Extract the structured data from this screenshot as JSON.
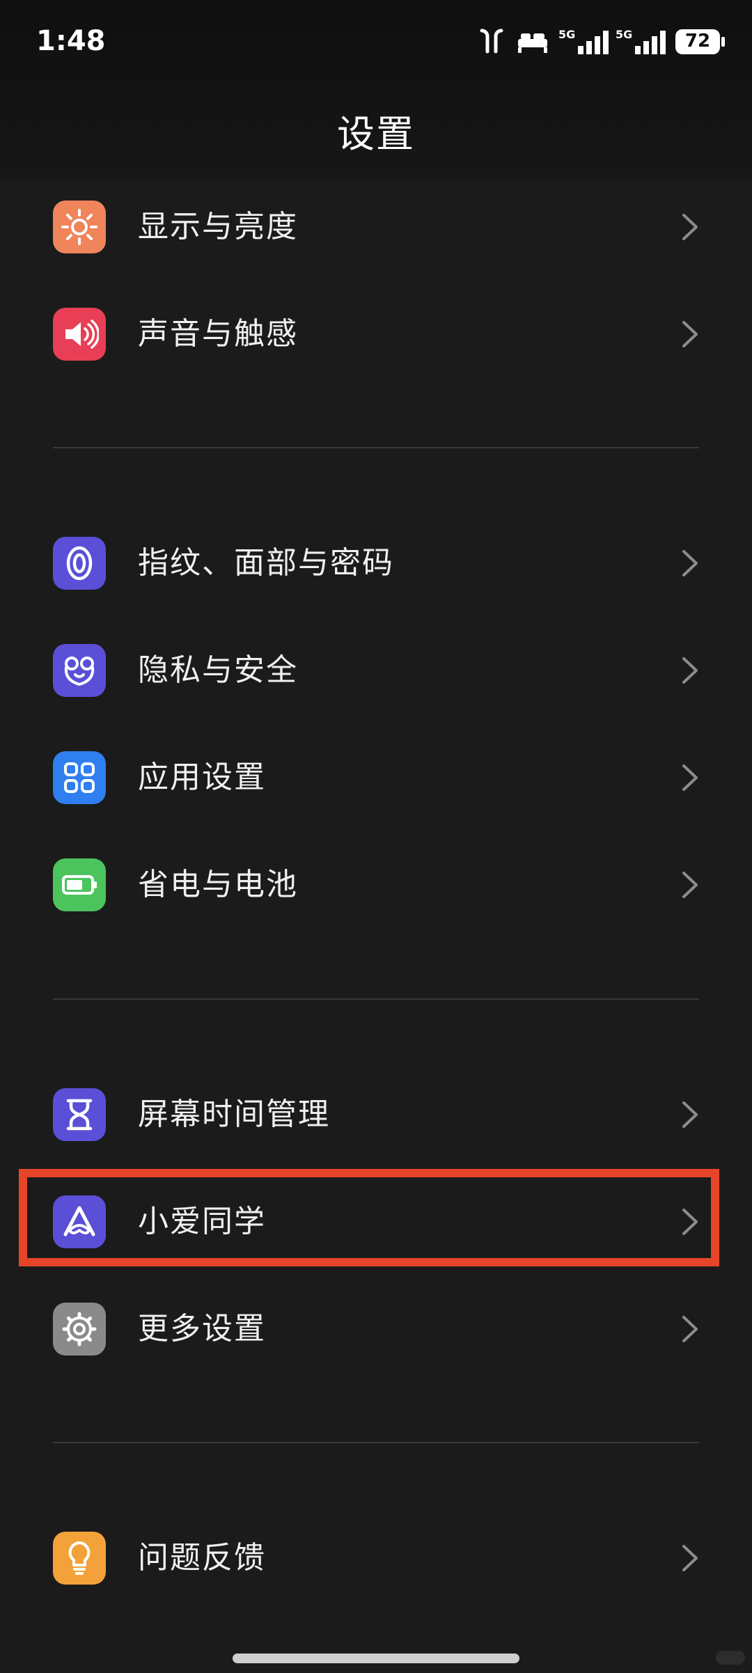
{
  "status_bar": {
    "time": "1:48",
    "battery": "72",
    "network1": "5G",
    "network2": "5G",
    "icons": [
      "earbuds-icon",
      "sleep-bed-icon",
      "signal-5g-icon",
      "signal-5g-icon",
      "battery-icon"
    ]
  },
  "header": {
    "title": "设置"
  },
  "groups": [
    {
      "items": [
        {
          "label": "显示与亮度",
          "icon": "sun-icon",
          "color": "#f0845a"
        },
        {
          "label": "声音与触感",
          "icon": "speaker-icon",
          "color": "#e83f56"
        }
      ]
    },
    {
      "items": [
        {
          "label": "指纹、面部与密码",
          "icon": "fingerprint-icon",
          "color": "#5a4fd6"
        },
        {
          "label": "隐私与安全",
          "icon": "privacy-icon",
          "color": "#5a4fd6"
        },
        {
          "label": "应用设置",
          "icon": "apps-grid-icon",
          "color": "#2f7ff0"
        },
        {
          "label": "省电与电池",
          "icon": "battery-icon",
          "color": "#4cc45e"
        }
      ]
    },
    {
      "items": [
        {
          "label": "屏幕时间管理",
          "icon": "hourglass-icon",
          "color": "#5a4fd6"
        },
        {
          "label": "小爱同学",
          "icon": "xiaoai-icon",
          "color": "#5a4fd6",
          "highlighted": true
        },
        {
          "label": "更多设置",
          "icon": "gear-icon",
          "color": "#8a8a8a"
        }
      ]
    },
    {
      "items": [
        {
          "label": "问题反馈",
          "icon": "lightbulb-icon",
          "color": "#f3a23b"
        }
      ]
    }
  ],
  "accent_colors": {
    "highlight_border": "#e6452a",
    "background": "#1b1b1b"
  }
}
